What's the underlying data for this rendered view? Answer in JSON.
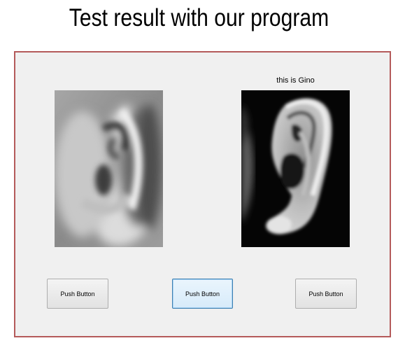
{
  "slide": {
    "title": "Test result with our program"
  },
  "gui": {
    "caption": "this is Gino",
    "left_image": {
      "icon": "blurred-ear-photo"
    },
    "right_image": {
      "icon": "ear-photo"
    },
    "buttons": [
      {
        "label": "Push Button",
        "state": "normal"
      },
      {
        "label": "Push Button",
        "state": "focused"
      },
      {
        "label": "Push Button",
        "state": "normal"
      }
    ]
  },
  "colors": {
    "window_background": "#f0f0f0",
    "window_border": "#b45a5a",
    "focus_border": "#3c7fb1"
  }
}
